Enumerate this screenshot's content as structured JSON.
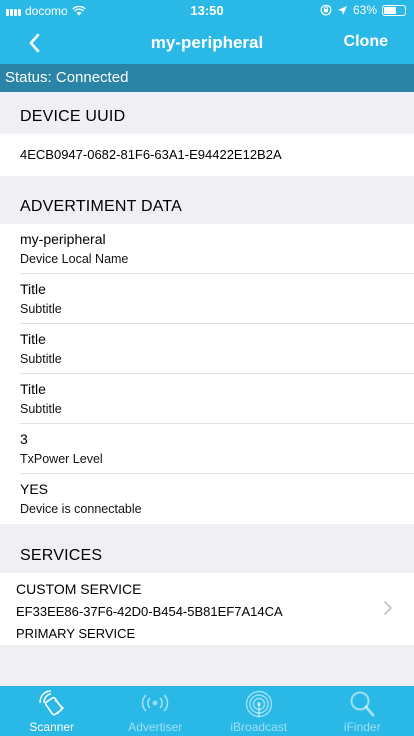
{
  "status_bar": {
    "carrier": "docomo",
    "time": "13:50",
    "battery": "63%",
    "battery_level": 0.63
  },
  "nav": {
    "title": "my-peripheral",
    "right_button": "Clone"
  },
  "status_strip": "Status: Connected",
  "device_uuid": {
    "header": "DEVICE UUID",
    "value": "4ECB0947-0682-81F6-63A1-E94422E12B2A"
  },
  "advertisement": {
    "header": "ADVERTIMENT DATA",
    "rows": [
      {
        "title": "my-peripheral",
        "subtitle": "Device Local Name"
      },
      {
        "title": "Title",
        "subtitle": "Subtitle"
      },
      {
        "title": "Title",
        "subtitle": "Subtitle"
      },
      {
        "title": "Title",
        "subtitle": "Subtitle"
      },
      {
        "title": "3",
        "subtitle": "TxPower Level"
      },
      {
        "title": "YES",
        "subtitle": "Device is connectable"
      }
    ]
  },
  "services": {
    "header": "SERVICES",
    "items": [
      {
        "name": "CUSTOM SERVICE",
        "uuid": "EF33EE86-37F6-42D0-B454-5B81EF7A14CA",
        "type": "PRIMARY SERVICE"
      }
    ]
  },
  "tabs": [
    {
      "label": "Scanner",
      "icon": "scanner-icon",
      "active": true
    },
    {
      "label": "Advertiser",
      "icon": "advertiser-icon",
      "active": false
    },
    {
      "label": "iBroadcast",
      "icon": "ibroadcast-icon",
      "active": false
    },
    {
      "label": "iFinder",
      "icon": "ifinder-icon",
      "active": false
    }
  ],
  "colors": {
    "nav_bar": "#2ab9e6",
    "status_strip": "#2a84a6",
    "background": "#efeff4"
  }
}
